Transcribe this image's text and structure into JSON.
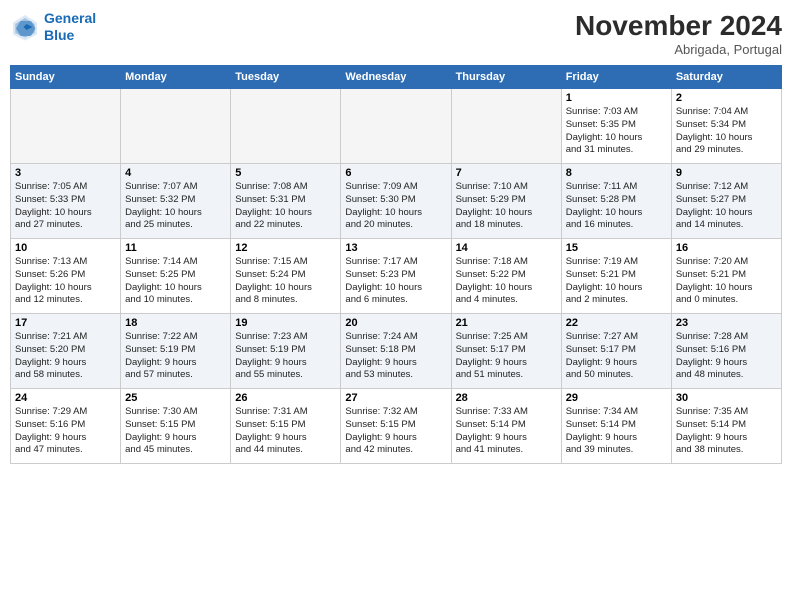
{
  "header": {
    "logo_line1": "General",
    "logo_line2": "Blue",
    "month": "November 2024",
    "location": "Abrigada, Portugal"
  },
  "weekdays": [
    "Sunday",
    "Monday",
    "Tuesday",
    "Wednesday",
    "Thursday",
    "Friday",
    "Saturday"
  ],
  "weeks": [
    [
      {
        "day": "",
        "info": ""
      },
      {
        "day": "",
        "info": ""
      },
      {
        "day": "",
        "info": ""
      },
      {
        "day": "",
        "info": ""
      },
      {
        "day": "",
        "info": ""
      },
      {
        "day": "1",
        "info": "Sunrise: 7:03 AM\nSunset: 5:35 PM\nDaylight: 10 hours\nand 31 minutes."
      },
      {
        "day": "2",
        "info": "Sunrise: 7:04 AM\nSunset: 5:34 PM\nDaylight: 10 hours\nand 29 minutes."
      }
    ],
    [
      {
        "day": "3",
        "info": "Sunrise: 7:05 AM\nSunset: 5:33 PM\nDaylight: 10 hours\nand 27 minutes."
      },
      {
        "day": "4",
        "info": "Sunrise: 7:07 AM\nSunset: 5:32 PM\nDaylight: 10 hours\nand 25 minutes."
      },
      {
        "day": "5",
        "info": "Sunrise: 7:08 AM\nSunset: 5:31 PM\nDaylight: 10 hours\nand 22 minutes."
      },
      {
        "day": "6",
        "info": "Sunrise: 7:09 AM\nSunset: 5:30 PM\nDaylight: 10 hours\nand 20 minutes."
      },
      {
        "day": "7",
        "info": "Sunrise: 7:10 AM\nSunset: 5:29 PM\nDaylight: 10 hours\nand 18 minutes."
      },
      {
        "day": "8",
        "info": "Sunrise: 7:11 AM\nSunset: 5:28 PM\nDaylight: 10 hours\nand 16 minutes."
      },
      {
        "day": "9",
        "info": "Sunrise: 7:12 AM\nSunset: 5:27 PM\nDaylight: 10 hours\nand 14 minutes."
      }
    ],
    [
      {
        "day": "10",
        "info": "Sunrise: 7:13 AM\nSunset: 5:26 PM\nDaylight: 10 hours\nand 12 minutes."
      },
      {
        "day": "11",
        "info": "Sunrise: 7:14 AM\nSunset: 5:25 PM\nDaylight: 10 hours\nand 10 minutes."
      },
      {
        "day": "12",
        "info": "Sunrise: 7:15 AM\nSunset: 5:24 PM\nDaylight: 10 hours\nand 8 minutes."
      },
      {
        "day": "13",
        "info": "Sunrise: 7:17 AM\nSunset: 5:23 PM\nDaylight: 10 hours\nand 6 minutes."
      },
      {
        "day": "14",
        "info": "Sunrise: 7:18 AM\nSunset: 5:22 PM\nDaylight: 10 hours\nand 4 minutes."
      },
      {
        "day": "15",
        "info": "Sunrise: 7:19 AM\nSunset: 5:21 PM\nDaylight: 10 hours\nand 2 minutes."
      },
      {
        "day": "16",
        "info": "Sunrise: 7:20 AM\nSunset: 5:21 PM\nDaylight: 10 hours\nand 0 minutes."
      }
    ],
    [
      {
        "day": "17",
        "info": "Sunrise: 7:21 AM\nSunset: 5:20 PM\nDaylight: 9 hours\nand 58 minutes."
      },
      {
        "day": "18",
        "info": "Sunrise: 7:22 AM\nSunset: 5:19 PM\nDaylight: 9 hours\nand 57 minutes."
      },
      {
        "day": "19",
        "info": "Sunrise: 7:23 AM\nSunset: 5:19 PM\nDaylight: 9 hours\nand 55 minutes."
      },
      {
        "day": "20",
        "info": "Sunrise: 7:24 AM\nSunset: 5:18 PM\nDaylight: 9 hours\nand 53 minutes."
      },
      {
        "day": "21",
        "info": "Sunrise: 7:25 AM\nSunset: 5:17 PM\nDaylight: 9 hours\nand 51 minutes."
      },
      {
        "day": "22",
        "info": "Sunrise: 7:27 AM\nSunset: 5:17 PM\nDaylight: 9 hours\nand 50 minutes."
      },
      {
        "day": "23",
        "info": "Sunrise: 7:28 AM\nSunset: 5:16 PM\nDaylight: 9 hours\nand 48 minutes."
      }
    ],
    [
      {
        "day": "24",
        "info": "Sunrise: 7:29 AM\nSunset: 5:16 PM\nDaylight: 9 hours\nand 47 minutes."
      },
      {
        "day": "25",
        "info": "Sunrise: 7:30 AM\nSunset: 5:15 PM\nDaylight: 9 hours\nand 45 minutes."
      },
      {
        "day": "26",
        "info": "Sunrise: 7:31 AM\nSunset: 5:15 PM\nDaylight: 9 hours\nand 44 minutes."
      },
      {
        "day": "27",
        "info": "Sunrise: 7:32 AM\nSunset: 5:15 PM\nDaylight: 9 hours\nand 42 minutes."
      },
      {
        "day": "28",
        "info": "Sunrise: 7:33 AM\nSunset: 5:14 PM\nDaylight: 9 hours\nand 41 minutes."
      },
      {
        "day": "29",
        "info": "Sunrise: 7:34 AM\nSunset: 5:14 PM\nDaylight: 9 hours\nand 39 minutes."
      },
      {
        "day": "30",
        "info": "Sunrise: 7:35 AM\nSunset: 5:14 PM\nDaylight: 9 hours\nand 38 minutes."
      }
    ]
  ]
}
